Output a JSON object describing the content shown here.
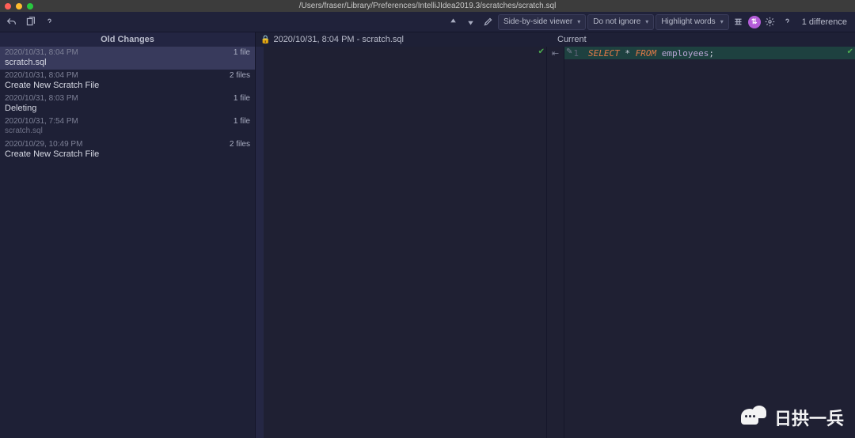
{
  "window": {
    "title": "/Users/fraser/Library/Preferences/IntelliJIdea2019.3/scratches/scratch.sql"
  },
  "toolbar": {
    "viewer_mode": "Side-by-side viewer",
    "ignore_mode": "Do not ignore",
    "highlight_mode": "Highlight words",
    "diff_count": "1 difference"
  },
  "sidebar": {
    "header": "Old Changes",
    "items": [
      {
        "ts": "2020/10/31, 8:04 PM",
        "count": "1 file",
        "desc": "scratch.sql",
        "sub": ""
      },
      {
        "ts": "2020/10/31, 8:04 PM",
        "count": "2 files",
        "desc": "Create New Scratch File",
        "sub": ""
      },
      {
        "ts": "2020/10/31, 8:03 PM",
        "count": "1 file",
        "desc": "Deleting",
        "sub": ""
      },
      {
        "ts": "2020/10/31, 7:54 PM",
        "count": "1 file",
        "desc": "",
        "sub": "scratch.sql"
      },
      {
        "ts": "2020/10/29, 10:49 PM",
        "count": "2 files",
        "desc": "Create New Scratch File",
        "sub": ""
      }
    ]
  },
  "diff": {
    "left_label": "2020/10/31, 8:04 PM - scratch.sql",
    "right_label": "Current",
    "right_code": {
      "line_no": "1",
      "kw_select": "SELECT",
      "star": " * ",
      "kw_from": "FROM",
      "space": " ",
      "ident": "employees",
      "semi": ";"
    }
  },
  "watermark": {
    "text": "日拱一兵"
  }
}
